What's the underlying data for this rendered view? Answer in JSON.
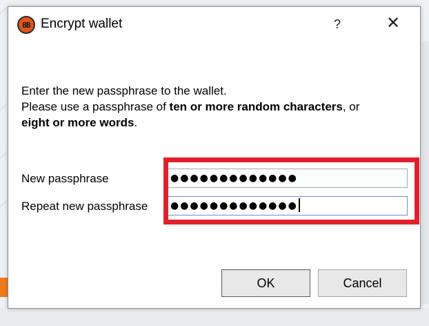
{
  "window": {
    "title": "Encrypt wallet",
    "icon_text": "BB",
    "help_label": "?",
    "close_label": "✕"
  },
  "description": {
    "line1": "Enter the new passphrase to the wallet.",
    "line2_prefix": "Please use a passphrase of ",
    "line2_bold": "ten or more random characters",
    "line2_suffix": ", or",
    "line3_bold": "eight or more words",
    "line3_suffix": "."
  },
  "form": {
    "new_label": "New passphrase",
    "new_value": "●●●●●●●●●●●●●",
    "repeat_label": "Repeat new passphrase",
    "repeat_value": "●●●●●●●●●●●●●"
  },
  "buttons": {
    "ok_label": "OK",
    "cancel_label": "Cancel"
  },
  "colors": {
    "highlight": "#e2202c",
    "app_icon": "#e3541a"
  }
}
